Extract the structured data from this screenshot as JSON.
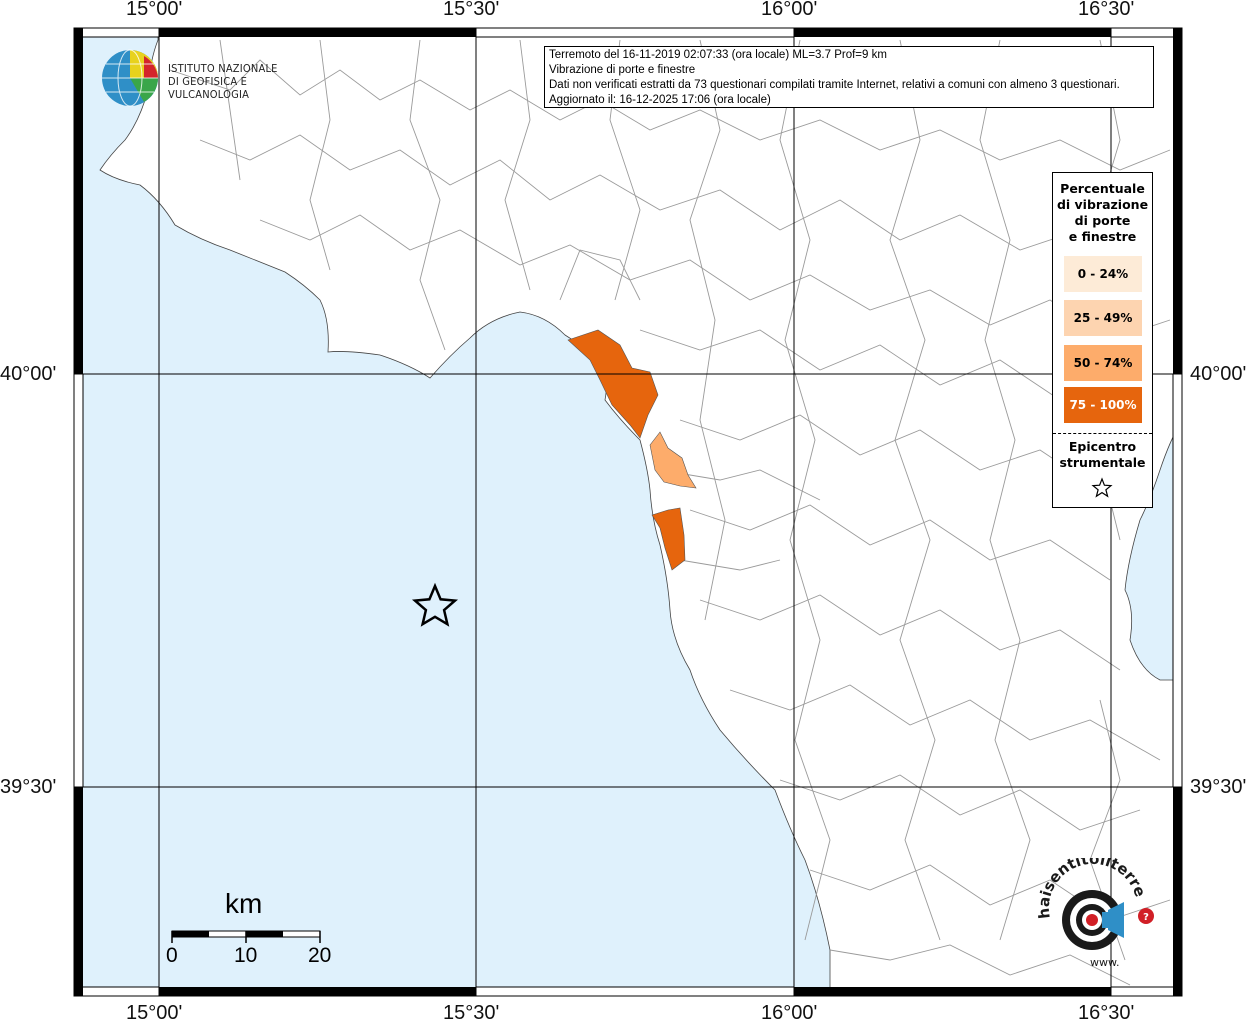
{
  "header": {
    "line1": "Terremoto del 16-11-2019 02:07:33 (ora locale) ML=3.7 Prof=9 km",
    "line2": "Vibrazione di porte e finestre",
    "line3": "Dati non verificati estratti da 73 questionari compilati tramite Internet, relativi a comuni con almeno 3 questionari.",
    "line4": "Aggiornato il: 16-12-2025 17:06 (ora locale)"
  },
  "ingv_logo": {
    "line1": "ISTITUTO NAZIONALE",
    "line2": "DI GEOFISICA E VULCANOLOGIA"
  },
  "axes": {
    "top_lon": [
      "15°00'",
      "15°30'",
      "16°00'",
      "16°30'"
    ],
    "bottom_lon": [
      "15°00'",
      "15°30'",
      "16°00'",
      "16°30'"
    ],
    "left_lat": [
      "40°00'",
      "39°30'"
    ],
    "right_lat": [
      "40°00'",
      "39°30'"
    ]
  },
  "legend": {
    "title_lines": [
      "Percentuale",
      "di vibrazione",
      "di porte",
      "e finestre"
    ],
    "classes": [
      {
        "label": "0 - 24%",
        "color": "#fdebd7",
        "text_color": "#000000"
      },
      {
        "label": "25 - 49%",
        "color": "#fdd4b0",
        "text_color": "#000000"
      },
      {
        "label": "50 - 74%",
        "color": "#fdac6b",
        "text_color": "#000000"
      },
      {
        "label": "75 - 100%",
        "color": "#e6650d",
        "text_color": "#ffffff"
      }
    ],
    "epicenter_lines": [
      "Epicentro",
      "strumentale"
    ]
  },
  "scale_bar": {
    "unit": "km",
    "ticks": [
      "0",
      "10",
      "20"
    ]
  },
  "site_logo": {
    "text": "haisentitoilterremoto.it",
    "prefix": "www."
  },
  "colors": {
    "sea": "#dff1fc",
    "land": "#ffffff",
    "boundary": "#8c8c8c",
    "grid": "#000000",
    "zone_high": "#e6650d",
    "zone_mid": "#fdac6b"
  }
}
